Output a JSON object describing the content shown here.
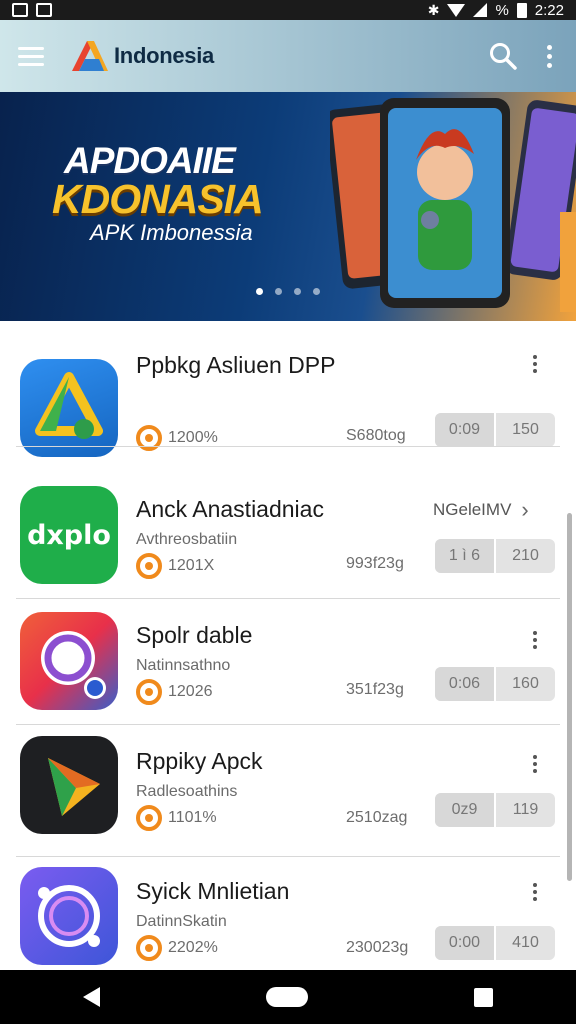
{
  "status_bar": {
    "time": "2:22",
    "battery_text": "%"
  },
  "app_bar": {
    "title": "Indonesia"
  },
  "banner": {
    "title_line1": "APDOAIIE",
    "title_line2": "KDONASIA",
    "subtitle": "APK Imbonessia",
    "slide_count": 4,
    "active_slide": 1
  },
  "apps": [
    {
      "name": "Ppbkg Asliuen DPP",
      "subtitle": "",
      "rating": "1200%",
      "size": "S680tog",
      "btn1": "0:09",
      "btn2": "150",
      "link": ""
    },
    {
      "name": "Anck Anastiadniac",
      "subtitle": "Avthreosbatiin",
      "rating": "1201X",
      "size": "993f23g",
      "btn1": "1 ì 6",
      "btn2": "210",
      "link": "NGeleIMV"
    },
    {
      "name": "Spolr dable",
      "subtitle": "Natinnsathno",
      "rating": "12026",
      "size": "351f23g",
      "btn1": "0:06",
      "btn2": "160",
      "link": ""
    },
    {
      "name": "Rppiky Apck",
      "subtitle": "Radlesoathins",
      "rating": "1101%",
      "size": "2510zag",
      "btn1": "0z9",
      "btn2": "119",
      "link": ""
    },
    {
      "name": "Syick Mnlietian",
      "subtitle": "DatinnSkatin",
      "rating": "2202%",
      "size": "230023g",
      "btn1": "0:00",
      "btn2": "410",
      "link": ""
    }
  ],
  "colors": {
    "app_bar_start": "#cfe6ea",
    "app_bar_end": "#7ba3bb",
    "banner_yellow": "#f7c22c",
    "rating_orange": "#f08a1c"
  },
  "icons": {
    "app_1": "drive-triangle-icon",
    "app_2": "dxplo-text-icon",
    "app_3": "ring-logo-icon",
    "app_4": "play-triangle-icon",
    "app_5": "circle-logo-icon"
  }
}
